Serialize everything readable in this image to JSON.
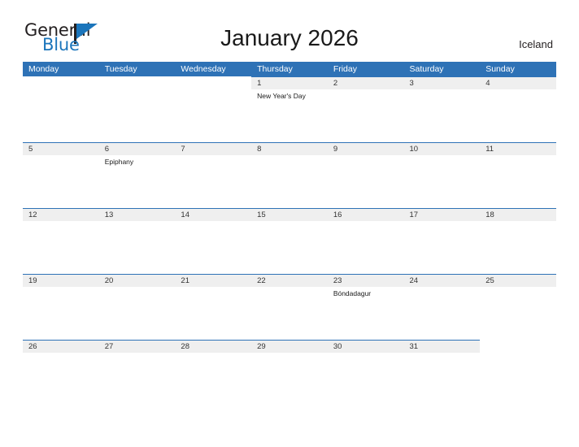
{
  "logo": {
    "text_primary": "General",
    "text_secondary": "Blue",
    "flag_color": "#1b75bb",
    "pole_color": "#231f20"
  },
  "header": {
    "title": "January 2026",
    "region": "Iceland"
  },
  "theme": {
    "header_blue": "#2e72b6",
    "band_gray": "#efefef",
    "text_dark": "#333333"
  },
  "calendar": {
    "weekdays": [
      "Monday",
      "Tuesday",
      "Wednesday",
      "Thursday",
      "Friday",
      "Saturday",
      "Sunday"
    ],
    "weeks": [
      [
        {
          "day": "",
          "event": ""
        },
        {
          "day": "",
          "event": ""
        },
        {
          "day": "",
          "event": ""
        },
        {
          "day": "1",
          "event": "New Year's Day"
        },
        {
          "day": "2",
          "event": ""
        },
        {
          "day": "3",
          "event": ""
        },
        {
          "day": "4",
          "event": ""
        }
      ],
      [
        {
          "day": "5",
          "event": ""
        },
        {
          "day": "6",
          "event": "Epiphany"
        },
        {
          "day": "7",
          "event": ""
        },
        {
          "day": "8",
          "event": ""
        },
        {
          "day": "9",
          "event": ""
        },
        {
          "day": "10",
          "event": ""
        },
        {
          "day": "11",
          "event": ""
        }
      ],
      [
        {
          "day": "12",
          "event": ""
        },
        {
          "day": "13",
          "event": ""
        },
        {
          "day": "14",
          "event": ""
        },
        {
          "day": "15",
          "event": ""
        },
        {
          "day": "16",
          "event": ""
        },
        {
          "day": "17",
          "event": ""
        },
        {
          "day": "18",
          "event": ""
        }
      ],
      [
        {
          "day": "19",
          "event": ""
        },
        {
          "day": "20",
          "event": ""
        },
        {
          "day": "21",
          "event": ""
        },
        {
          "day": "22",
          "event": ""
        },
        {
          "day": "23",
          "event": "Bóndadagur"
        },
        {
          "day": "24",
          "event": ""
        },
        {
          "day": "25",
          "event": ""
        }
      ],
      [
        {
          "day": "26",
          "event": ""
        },
        {
          "day": "27",
          "event": ""
        },
        {
          "day": "28",
          "event": ""
        },
        {
          "day": "29",
          "event": ""
        },
        {
          "day": "30",
          "event": ""
        },
        {
          "day": "31",
          "event": ""
        },
        {
          "day": "",
          "event": ""
        }
      ]
    ]
  }
}
